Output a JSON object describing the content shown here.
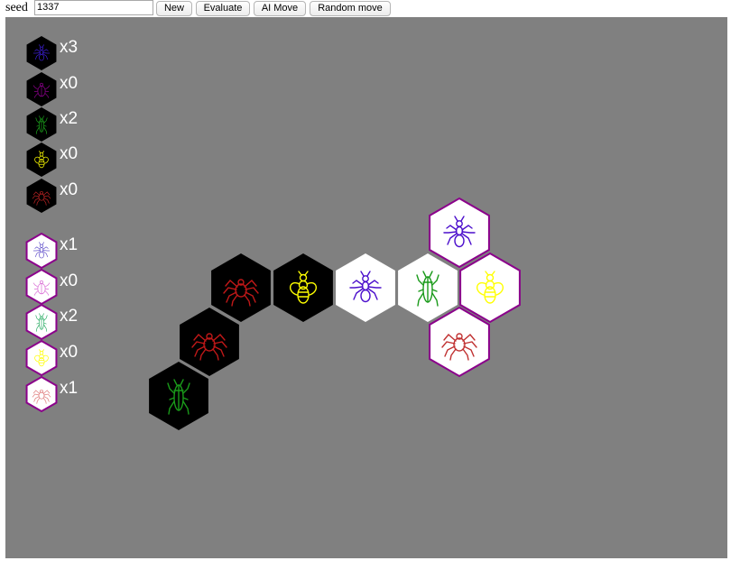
{
  "toolbar": {
    "seed_label": "seed",
    "seed_value": "1337",
    "new_label": "New",
    "evaluate_label": "Evaluate",
    "ai_move_label": "AI Move",
    "random_move_label": "Random move"
  },
  "colors": {
    "board_bg": "#808080",
    "black_tile": "#000000",
    "white_tile": "#ffffff",
    "border_purple": "#8b008b",
    "queen": "#ffff00",
    "spider": "#b22222",
    "beetle_black": "#8b008b",
    "beetle_white": "#da70d6",
    "ant": "#4b0ecc",
    "grasshopper": "#1a9a1a"
  },
  "reserve_black": [
    {
      "insect": "ant",
      "icon": "ant-icon",
      "color": "#3b1ed0",
      "count": "x3"
    },
    {
      "insect": "beetle",
      "icon": "beetle-icon",
      "color": "#8b008b",
      "count": "x0"
    },
    {
      "insect": "grasshopper",
      "icon": "grasshopper-icon",
      "color": "#1a9a1a",
      "count": "x2"
    },
    {
      "insect": "queen",
      "icon": "queen-bee-icon",
      "color": "#ffff00",
      "count": "x0"
    },
    {
      "insect": "spider",
      "icon": "spider-icon",
      "color": "#b22222",
      "count": "x0"
    }
  ],
  "reserve_white": [
    {
      "insect": "ant",
      "icon": "ant-icon",
      "color": "#6a5acd",
      "count": "x1"
    },
    {
      "insect": "beetle",
      "icon": "beetle-icon",
      "color": "#da70d6",
      "count": "x0"
    },
    {
      "insect": "grasshopper",
      "icon": "grasshopper-icon",
      "color": "#3cb371",
      "count": "x2"
    },
    {
      "insect": "queen",
      "icon": "queen-bee-icon",
      "color": "#ffff00",
      "count": "x0"
    },
    {
      "insect": "spider",
      "icon": "spider-icon",
      "color": "#e08080",
      "count": "x1"
    }
  ],
  "board": [
    {
      "owner": "black",
      "insect": "spider",
      "icon": "spider-icon",
      "color": "#c01818"
    },
    {
      "owner": "black",
      "insect": "queen",
      "icon": "queen-bee-icon",
      "color": "#ffff00"
    },
    {
      "owner": "white",
      "insect": "ant",
      "icon": "ant-icon",
      "color": "#4b0ecc"
    },
    {
      "owner": "white",
      "insect": "grasshopper",
      "icon": "grasshopper-icon",
      "color": "#1a9a1a"
    },
    {
      "owner": "white",
      "insect": "queen",
      "icon": "queen-bee-icon",
      "color": "#ffff00",
      "highlight": true
    },
    {
      "owner": "white",
      "insect": "ant",
      "icon": "ant-icon",
      "color": "#4b0ecc",
      "highlight": true
    },
    {
      "owner": "white",
      "insect": "spider",
      "icon": "spider-icon",
      "color": "#c03030",
      "highlight": true
    },
    {
      "owner": "black",
      "insect": "spider",
      "icon": "spider-icon",
      "color": "#c01818"
    },
    {
      "owner": "black",
      "insect": "grasshopper",
      "icon": "grasshopper-icon",
      "color": "#1a9a1a"
    }
  ]
}
